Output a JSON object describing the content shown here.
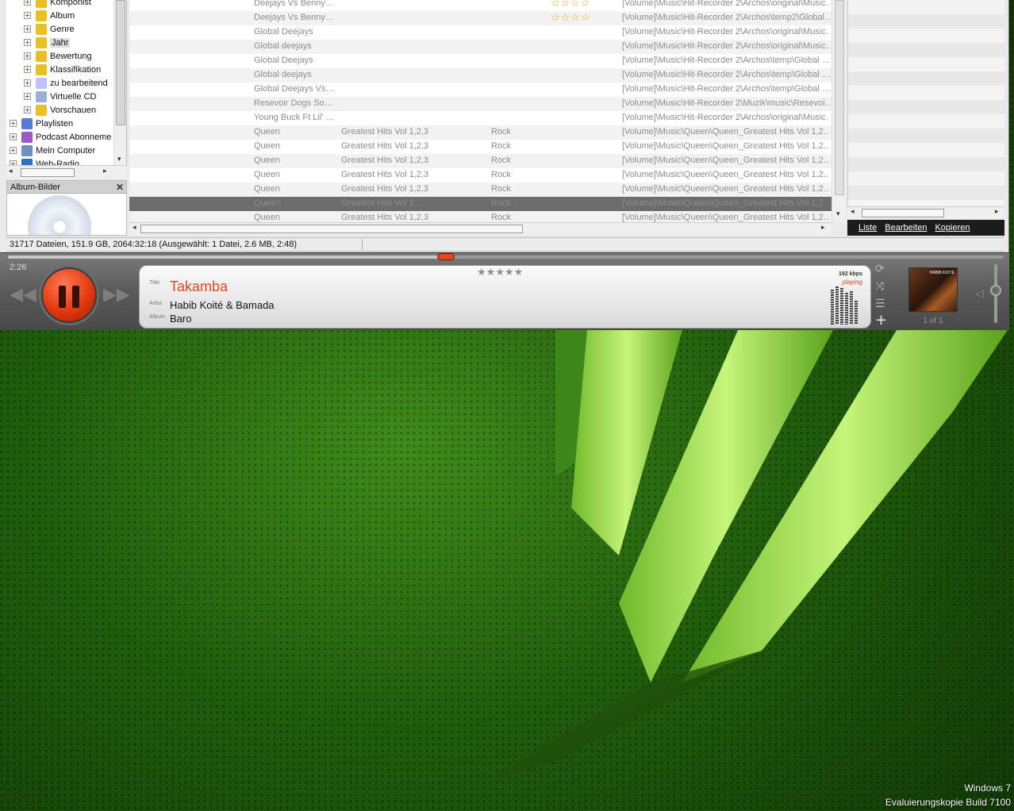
{
  "tree": {
    "items": [
      {
        "label": "Komponist",
        "indent": 1
      },
      {
        "label": "Album",
        "indent": 1
      },
      {
        "label": "Genre",
        "indent": 1
      },
      {
        "label": "Jahr",
        "indent": 1,
        "selected": true
      },
      {
        "label": "Bewertung",
        "indent": 1
      },
      {
        "label": "Klassifikation",
        "indent": 1
      },
      {
        "label": "zu bearbeitend",
        "indent": 1
      },
      {
        "label": "Virtuelle CD",
        "indent": 1
      },
      {
        "label": "Vorschauen",
        "indent": 1
      },
      {
        "label": "Playlisten",
        "indent": 0
      },
      {
        "label": "Podcast Abonneme",
        "indent": 0
      },
      {
        "label": "Mein Computer",
        "indent": 0
      },
      {
        "label": "Web-Radio",
        "indent": 0
      }
    ]
  },
  "album_panel": {
    "title": "Album-Bilder",
    "close": "✕"
  },
  "tracks": [
    {
      "artist": "Deejays Vs Benny…",
      "album": "",
      "genre": "",
      "rating": "☆☆☆☆",
      "path": "[Volume]\\Music\\Hit-Recorder 2\\Archos\\original\\Music…"
    },
    {
      "artist": "Deejays Vs Benny…",
      "album": "",
      "genre": "",
      "rating": "☆☆☆☆",
      "path": "[Volume]\\Music\\Hit-Recorder 2\\Archos\\temp2\\Global…"
    },
    {
      "artist": "Global Deejays",
      "album": "",
      "genre": "",
      "rating": "",
      "path": "[Volume]\\Music\\Hit-Recorder 2\\Archos\\original\\Music…"
    },
    {
      "artist": "Global deejays",
      "album": "",
      "genre": "",
      "rating": "",
      "path": "[Volume]\\Music\\Hit-Recorder 2\\Archos\\original\\Music…"
    },
    {
      "artist": "Global Deejays",
      "album": "",
      "genre": "",
      "rating": "",
      "path": "[Volume]\\Music\\Hit-Recorder 2\\Archos\\temp\\Global …"
    },
    {
      "artist": "Global deejays",
      "album": "",
      "genre": "",
      "rating": "",
      "path": "[Volume]\\Music\\Hit-Recorder 2\\Archos\\temp\\Global …"
    },
    {
      "artist": "Global Deejays Vs…",
      "album": "",
      "genre": "",
      "rating": "",
      "path": "[Volume]\\Music\\Hit-Recorder 2\\Archos\\temp\\Global …"
    },
    {
      "artist": "Resevoir Dogs So…",
      "album": "",
      "genre": "",
      "rating": "",
      "path": "[Volume]\\Music\\Hit-Recorder 2\\Muzik\\music\\Resevoi…"
    },
    {
      "artist": "Young Buck Ft Lil' …",
      "album": "",
      "genre": "",
      "rating": "",
      "path": "[Volume]\\Music\\Hit-Recorder 2\\Archos\\original\\Music…"
    },
    {
      "artist": "Queen",
      "album": "Greatest Hits Vol 1,2,3",
      "genre": "Rock",
      "rating": "",
      "path": "[Volume]\\Music\\Queen\\Queen_Greatest Hits Vol 1,2…"
    },
    {
      "artist": "Queen",
      "album": "Greatest Hits Vol 1,2,3",
      "genre": "Rock",
      "rating": "",
      "path": "[Volume]\\Music\\Queen\\Queen_Greatest Hits Vol 1,2…"
    },
    {
      "artist": "Queen",
      "album": "Greatest Hits Vol 1,2,3",
      "genre": "Rock",
      "rating": "",
      "path": "[Volume]\\Music\\Queen\\Queen_Greatest Hits Vol 1,2…"
    },
    {
      "artist": "Queen",
      "album": "Greatest Hits Vol 1,2,3",
      "genre": "Rock",
      "rating": "",
      "path": "[Volume]\\Music\\Queen\\Queen_Greatest Hits Vol 1,2…"
    },
    {
      "artist": "Queen",
      "album": "Greatest Hits Vol 1,2,3",
      "genre": "Rock",
      "rating": "",
      "path": "[Volume]\\Music\\Queen\\Queen_Greatest Hits Vol 1,2…"
    },
    {
      "artist": "Queen",
      "album": "Greatest Hits Vol 1…",
      "genre": "Rock",
      "rating": "",
      "path": "[Volume]\\Music\\Queen\\Queen_Greatest Hits Vol 1,2…",
      "selected": true
    },
    {
      "artist": "Queen",
      "album": "Greatest Hits Vol 1,2,3",
      "genre": "Rock",
      "rating": "",
      "path": "[Volume]\\Music\\Queen\\Queen_Greatest Hits Vol 1,2…"
    }
  ],
  "right_toolbar": {
    "list": "Liste",
    "edit": "Bearbeiten",
    "copy": "Kopieren"
  },
  "status": {
    "text": "31717 Dateien, 151.9 GB, 2064:32:18 (Ausgewählt: 1 Datei, 2.6 MB, 2:48)"
  },
  "player": {
    "elapsed": "2:26",
    "progress_fraction": 0.44,
    "title_label": "Title",
    "artist_label": "Artist",
    "album_label": "Album",
    "title": "Takamba",
    "artist": "Habib Koité & Bamada",
    "album": "Baro",
    "rating_stars": "★★★★★",
    "kbps": "192 kbps",
    "state": "playing",
    "cover_count": "1 of 1",
    "cover_text": "HABIB KOITÉ",
    "volume_fraction": 0.55,
    "accent_color": "#e4461e"
  },
  "desktop": {
    "watermark_line1": "Windows 7",
    "watermark_line2": "Evaluierungskopie Build 7100"
  }
}
